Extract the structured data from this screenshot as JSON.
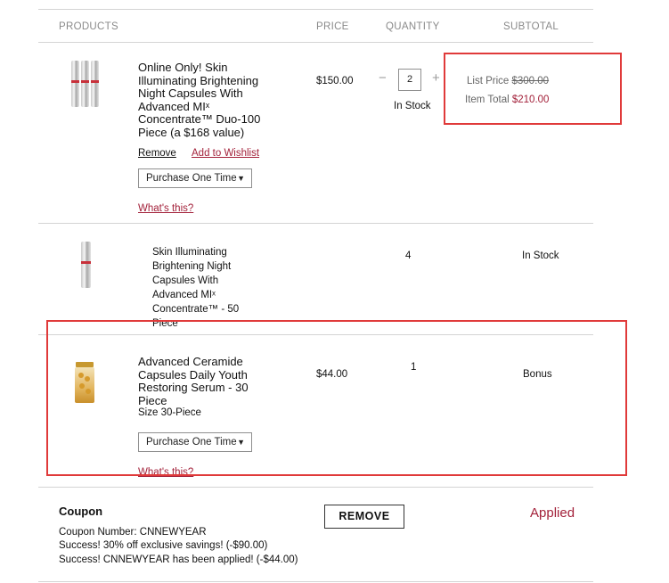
{
  "table_header": {
    "products": "PRODUCTS",
    "price": "PRICE",
    "quantity": "QUANTITY",
    "subtotal": "SUBTOTAL"
  },
  "item1": {
    "name_lines": [
      "Online Only! Skin",
      "Illuminating Brightening",
      "Night Capsules With",
      "Advanced MIˣ",
      "Concentrate™ Duo-100",
      "Piece (a $168 value)"
    ],
    "price": "$150.00",
    "quantity": "2",
    "minus": "−",
    "plus": "+",
    "stock": "In Stock",
    "list_price_label": "List Price",
    "list_price_value": "$300.00",
    "item_total_label": "Item Total",
    "item_total_value": "$210.00",
    "remove": "Remove",
    "wishlist": "Add to Wishlist",
    "purchase_option": "Purchase One Time",
    "whats_this": "What's this?"
  },
  "item2": {
    "name_lines": [
      "Skin Illuminating",
      "Brightening Night",
      "Capsules With",
      "Advanced MIˣ",
      "Concentrate™ - 50",
      "Piece"
    ],
    "quantity": "4",
    "stock": "In Stock"
  },
  "item3": {
    "name_lines": [
      "Advanced Ceramide",
      "Capsules Daily Youth",
      "Restoring Serum - 30",
      "Piece"
    ],
    "size": "Size 30-Piece",
    "price": "$44.00",
    "quantity": "1",
    "subtotal": "Bonus",
    "purchase_option": "Purchase One Time",
    "whats_this": "What's this?"
  },
  "coupon": {
    "title": "Coupon",
    "number": "Coupon Number: CNNEWYEAR",
    "success1": "Success! 30% off exclusive savings! (-$90.00)",
    "success2": "Success! CNNEWYEAR has been applied! (-$44.00)",
    "remove_button": "REMOVE",
    "status": "Applied"
  },
  "colors": {
    "accent_red": "#a3213a",
    "highlight_border": "#e03a3a"
  }
}
